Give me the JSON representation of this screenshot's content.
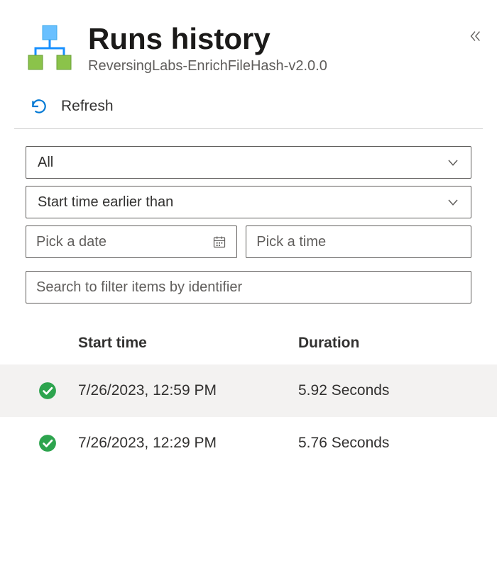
{
  "header": {
    "title": "Runs history",
    "subtitle": "ReversingLabs-EnrichFileHash-v2.0.0"
  },
  "toolbar": {
    "refresh_label": "Refresh"
  },
  "filters": {
    "status_selected": "All",
    "time_filter_selected": "Start time earlier than",
    "date_placeholder": "Pick a date",
    "time_placeholder": "Pick a time",
    "search_placeholder": "Search to filter items by identifier"
  },
  "table": {
    "columns": {
      "start": "Start time",
      "duration": "Duration"
    },
    "rows": [
      {
        "status": "succeeded",
        "start": "7/26/2023, 12:59 PM",
        "duration": "5.92 Seconds"
      },
      {
        "status": "succeeded",
        "start": "7/26/2023, 12:29 PM",
        "duration": "5.76 Seconds"
      }
    ]
  }
}
